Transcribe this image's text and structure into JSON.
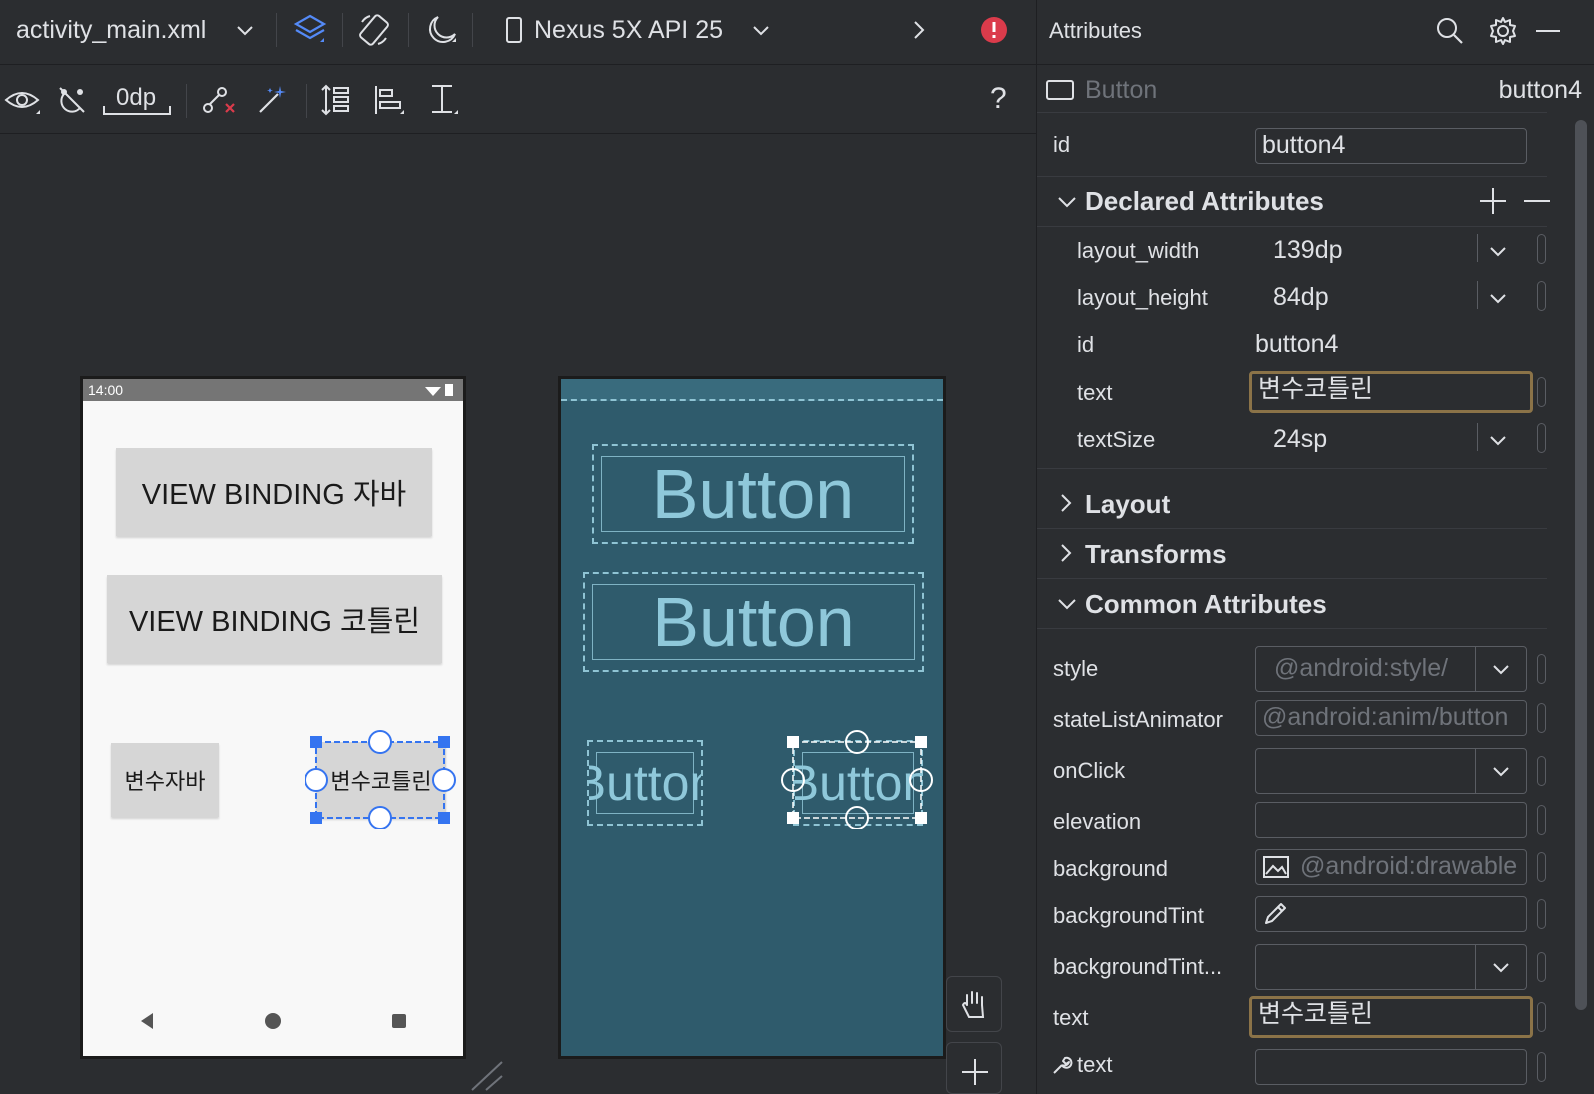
{
  "toolbar": {
    "file_name": "activity_main.xml",
    "device": "Nexus 5X API 25",
    "margin_value": "0dp",
    "help_label": "?"
  },
  "phone_preview": {
    "status_time": "14:00",
    "buttons": [
      {
        "label": "VIEW BINDING 자바"
      },
      {
        "label": "VIEW BINDING 코틀린"
      },
      {
        "label": "변수자바"
      },
      {
        "label": "변수코틀린"
      }
    ]
  },
  "blueprint": {
    "buttons": [
      {
        "label": "Button"
      },
      {
        "label": "Button"
      },
      {
        "label": "Button"
      },
      {
        "label": "Button"
      }
    ]
  },
  "attributes": {
    "title": "Attributes",
    "component_type": "Button",
    "component_id": "button4",
    "id_label": "id",
    "id_value": "button4",
    "sections": {
      "declared": "Declared Attributes",
      "layout": "Layout",
      "transforms": "Transforms",
      "common": "Common Attributes"
    },
    "declared": [
      {
        "name": "layout_width",
        "value": "139dp"
      },
      {
        "name": "layout_height",
        "value": "84dp"
      },
      {
        "name": "id",
        "value": "button4"
      },
      {
        "name": "text",
        "value": "변수코틀린"
      },
      {
        "name": "textSize",
        "value": "24sp"
      }
    ],
    "common": [
      {
        "name": "style",
        "value": "@android:style/"
      },
      {
        "name": "stateListAnimator",
        "value": "@android:anim/button"
      },
      {
        "name": "onClick",
        "value": ""
      },
      {
        "name": "elevation",
        "value": ""
      },
      {
        "name": "background",
        "value": "@android:drawable"
      },
      {
        "name": "backgroundTint",
        "value": ""
      },
      {
        "name": "backgroundTint...",
        "value": ""
      },
      {
        "name": "text",
        "value": "변수코틀린"
      },
      {
        "name": "text",
        "value": ""
      }
    ]
  },
  "colors": {
    "background": "#2b2d30",
    "accent_blue": "#3574f0",
    "error_red": "#db3b4b",
    "focus_border": "#8b7348",
    "blueprint_bg": "#2f5b6c"
  }
}
